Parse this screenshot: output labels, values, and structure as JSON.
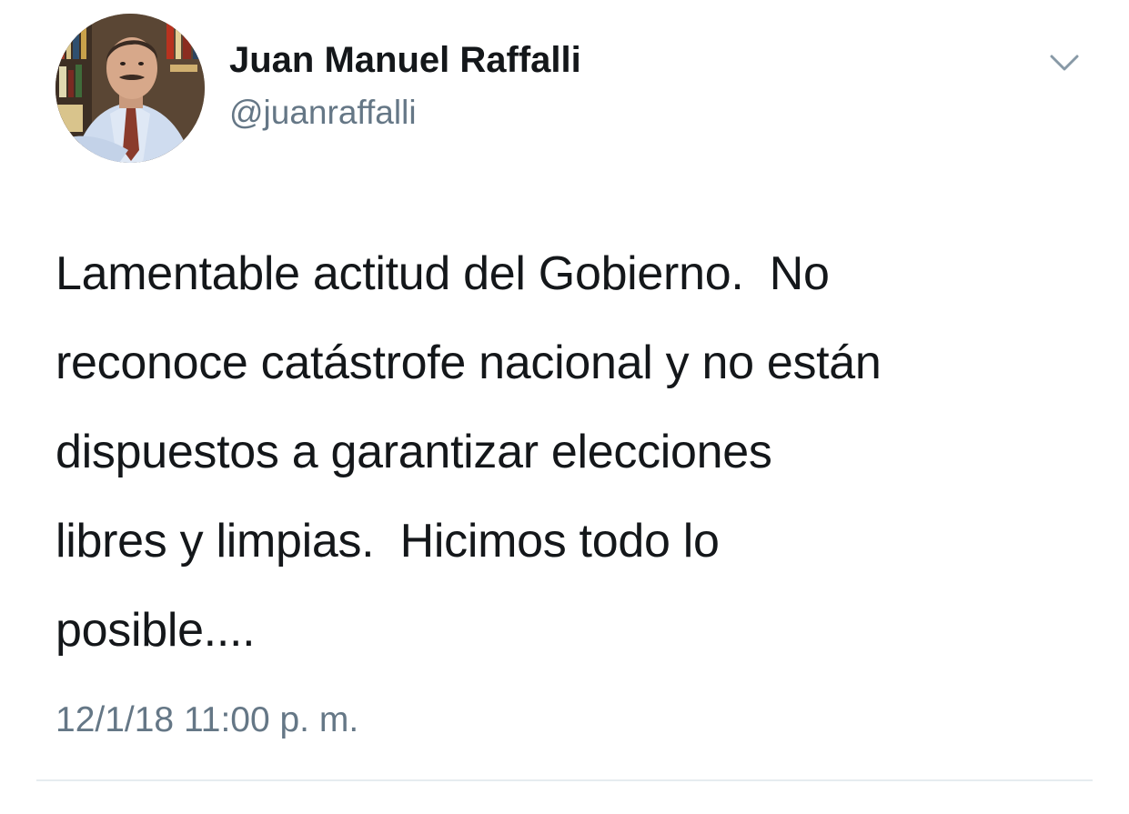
{
  "tweet": {
    "display_name": "Juan Manuel Raffalli",
    "handle": "@juanraffalli",
    "text": "Lamentable actitud del Gobierno.  No\nreconoce catástrofe nacional y no están\ndispuestos a garantizar elecciones\nlibres y limpias.  Hicimos todo lo\nposible....",
    "timestamp": "12/1/18 11:00 p. m.",
    "avatar_icon": "profile-photo",
    "menu_icon": "chevron-down-icon"
  },
  "colors": {
    "text_primary": "#14171a",
    "text_secondary": "#657786",
    "divider": "#e6ecf0",
    "background": "#ffffff"
  }
}
